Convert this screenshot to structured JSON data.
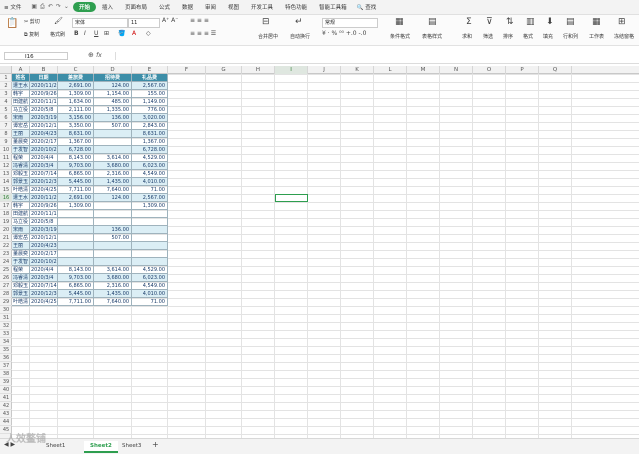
{
  "menu": {
    "file": "≡ 文件",
    "tabs": [
      "开始",
      "插入",
      "页面布局",
      "公式",
      "数据",
      "审阅",
      "视图",
      "开发工具",
      "特色功能",
      "智能工具箱"
    ],
    "active_tab": "开始",
    "search": "查找"
  },
  "ribbon": {
    "cut": "剪切",
    "copy": "复制",
    "format_painter": "格式刷",
    "font_name": "宋体",
    "font_size": "11",
    "number_format": "常规",
    "merge": "合并居中",
    "wrap": "自动换行",
    "conditional": "条件格式",
    "table_style": "表格样式",
    "sum": "求和",
    "filter": "筛选",
    "sort": "排序",
    "format": "格式",
    "fill": "填充",
    "row_col": "行和列",
    "worksheet": "工作表",
    "freeze": "冻结窗格"
  },
  "formula_bar": {
    "cell_ref": "I16",
    "fx": "fx",
    "value": ""
  },
  "columns": [
    "A",
    "B",
    "C",
    "D",
    "E",
    "F",
    "G",
    "H",
    "I",
    "J",
    "K",
    "L",
    "M",
    "N",
    "O",
    "P",
    "Q"
  ],
  "selected_column": "I",
  "selected_row": 16,
  "table": {
    "headers": [
      "姓名",
      "日期",
      "差旅费",
      "招待费",
      "礼品费"
    ],
    "rows": [
      {
        "name": "遭王水",
        "date": "2020/11/23",
        "travel": "2,691.00",
        "hosp": "124.00",
        "gift": "2,567.00",
        "hl": true
      },
      {
        "name": "韩宇",
        "date": "2020/9/26",
        "travel": "1,309.00",
        "hosp": "1,154.00",
        "gift": "155.00",
        "hl": false
      },
      {
        "name": "田建航",
        "date": "2020/11/17",
        "travel": "1,634.00",
        "hosp": "485.00",
        "gift": "1,149.00",
        "hl": false
      },
      {
        "name": "马立役",
        "date": "2020/5/8",
        "travel": "2,111.00",
        "hosp": "1,335.00",
        "gift": "776.00",
        "hl": false
      },
      {
        "name": "宋雨",
        "date": "2020/3/19",
        "travel": "3,156.00",
        "hosp": "136.00",
        "gift": "3,020.00",
        "hl": true
      },
      {
        "name": "谭宏岳",
        "date": "2020/12/11",
        "travel": "3,350.00",
        "hosp": "507.00",
        "gift": "2,843.00",
        "hl": false
      },
      {
        "name": "王丽",
        "date": "2020/4/23",
        "travel": "8,631.00",
        "hosp": "",
        "gift": "8,631.00",
        "hl": true
      },
      {
        "name": "董晨奕",
        "date": "2020/2/17",
        "travel": "1,367.00",
        "hosp": "",
        "gift": "1,367.00",
        "hl": false
      },
      {
        "name": "于发智",
        "date": "2020/10/26",
        "travel": "6,728.00",
        "hosp": "",
        "gift": "6,728.00",
        "hl": true
      },
      {
        "name": "程荣",
        "date": "2020/4/4",
        "travel": "8,143.00",
        "hosp": "3,614.00",
        "gift": "4,529.00",
        "hl": false
      },
      {
        "name": "冯睿清",
        "date": "2020/3/4",
        "travel": "9,703.00",
        "hosp": "3,680.00",
        "gift": "6,023.00",
        "hl": true
      },
      {
        "name": "邓毅玉",
        "date": "2020/7/14",
        "travel": "6,865.00",
        "hosp": "2,316.00",
        "gift": "4,549.00",
        "hl": false
      },
      {
        "name": "郭景玉",
        "date": "2020/12/31",
        "travel": "5,445.00",
        "hosp": "1,435.00",
        "gift": "4,010.00",
        "hl": true
      },
      {
        "name": "叶皓清",
        "date": "2020/4/25",
        "travel": "7,711.00",
        "hosp": "7,640.00",
        "gift": "71.00",
        "hl": false
      },
      {
        "name": "遭王水",
        "date": "2020/11/23",
        "travel": "2,691.00",
        "hosp": "124.00",
        "gift": "2,567.00",
        "hl": true
      },
      {
        "name": "韩宇",
        "date": "2020/9/26",
        "travel": "1,309.00",
        "hosp": "",
        "gift": "1,309.00",
        "hl": false
      },
      {
        "name": "田建航",
        "date": "2020/11/17",
        "travel": "",
        "hosp": "",
        "gift": "",
        "hl": false
      },
      {
        "name": "马立役",
        "date": "2020/5/8",
        "travel": "",
        "hosp": "",
        "gift": "",
        "hl": false
      },
      {
        "name": "宋雨",
        "date": "2020/3/19",
        "travel": "",
        "hosp": "136.00",
        "gift": "",
        "hl": true
      },
      {
        "name": "谭宏岳",
        "date": "2020/12/11",
        "travel": "",
        "hosp": "507.00",
        "gift": "",
        "hl": false
      },
      {
        "name": "王丽",
        "date": "2020/4/23",
        "travel": "",
        "hosp": "",
        "gift": "",
        "hl": true
      },
      {
        "name": "董晨奕",
        "date": "2020/2/17",
        "travel": "",
        "hosp": "",
        "gift": "",
        "hl": false
      },
      {
        "name": "于发智",
        "date": "2020/10/26",
        "travel": "",
        "hosp": "",
        "gift": "",
        "hl": true
      },
      {
        "name": "程荣",
        "date": "2020/4/4",
        "travel": "8,143.00",
        "hosp": "3,614.00",
        "gift": "4,529.00",
        "hl": false
      },
      {
        "name": "冯睿清",
        "date": "2020/3/4",
        "travel": "9,703.00",
        "hosp": "3,680.00",
        "gift": "6,023.00",
        "hl": true
      },
      {
        "name": "邓毅玉",
        "date": "2020/7/14",
        "travel": "6,865.00",
        "hosp": "2,316.00",
        "gift": "4,549.00",
        "hl": false
      },
      {
        "name": "郭景玉",
        "date": "2020/12/31",
        "travel": "5,445.00",
        "hosp": "1,435.00",
        "gift": "4,010.00",
        "hl": true
      },
      {
        "name": "叶皓清",
        "date": "2020/4/25",
        "travel": "7,711.00",
        "hosp": "7,640.00",
        "gift": "71.00",
        "hl": false
      }
    ]
  },
  "sheets": [
    "Sheet1",
    "Sheet2",
    "Sheet3"
  ],
  "active_sheet": "Sheet2",
  "watermark": "人效鳌铺",
  "colors": {
    "accent": "#2e9e4f",
    "header_fill": "#3d8ea8",
    "band_fill": "#dbeef5"
  }
}
